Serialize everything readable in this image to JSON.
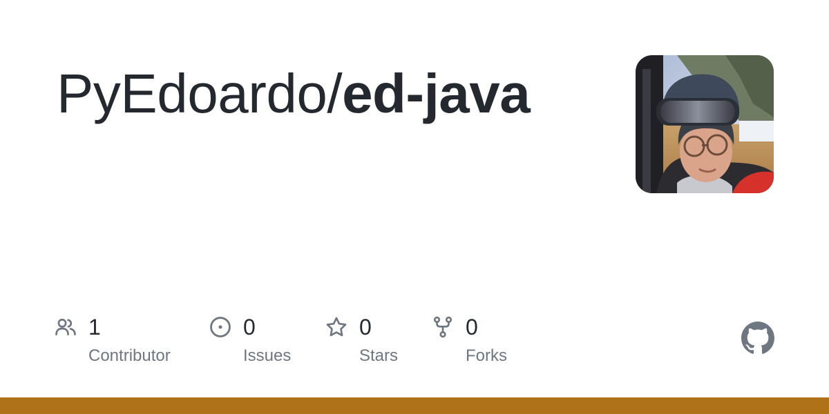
{
  "repo": {
    "owner": "PyEdoardo",
    "separator": "/",
    "name": "ed-java"
  },
  "avatar": {
    "alt": "PyEdoardo avatar"
  },
  "stats": [
    {
      "icon": "people-icon",
      "value": "1",
      "label": "Contributor"
    },
    {
      "icon": "issue-opened-icon",
      "value": "0",
      "label": "Issues"
    },
    {
      "icon": "star-icon",
      "value": "0",
      "label": "Stars"
    },
    {
      "icon": "repo-forked-icon",
      "value": "0",
      "label": "Forks"
    }
  ],
  "logo": {
    "icon": "github-mark-icon"
  },
  "language_bar": {
    "color": "#b07219"
  },
  "colors": {
    "text_primary": "#24292f",
    "text_secondary": "#6e7781",
    "icon": "#6e7781"
  }
}
